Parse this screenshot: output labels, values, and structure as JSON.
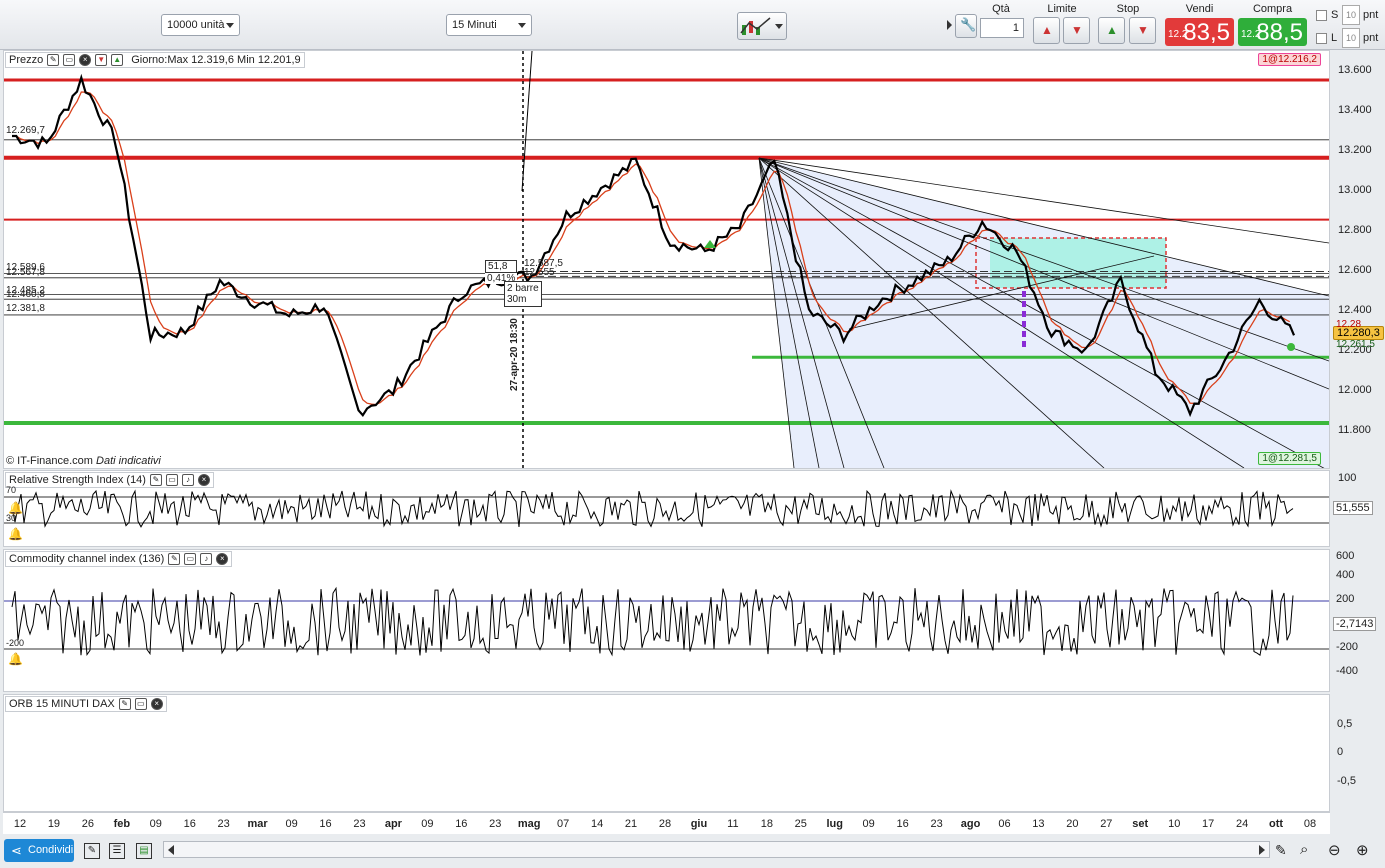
{
  "toolbar": {
    "units": "10000 unità",
    "timeframe": "15 Minuti",
    "qty_label": "Qtà",
    "qty_value": "1",
    "limit_label": "Limite",
    "stop_label": "Stop",
    "sell_label": "Vendi",
    "buy_label": "Compra",
    "sell_small": "12.2",
    "sell_big": "83,5",
    "buy_small": "12.2",
    "buy_big": "88,5",
    "s_label": "S",
    "l_label": "L",
    "s_pnt": "10",
    "l_pnt": "10",
    "pnt_label": "pnt",
    "colors": {
      "sell": "#e23a3a",
      "buy": "#2fae3a"
    }
  },
  "price_panel": {
    "title": "Prezzo",
    "info": "Giorno:Max 12.319,6 Min 12.201,9",
    "order_tag_top": "1@12.216,2",
    "order_tag_bottom": "1@12.281,5",
    "source": "© IT-Finance.com",
    "source_note": "Dati indicativi",
    "price_tag": "12.280,3",
    "price_tag2": "12.261,5",
    "price_tag3": "12.28",
    "levels_left": [
      "12.269,7",
      "12.589,6",
      "12.567,8",
      "12.485,2",
      "12.460,8",
      "12.381,8"
    ],
    "tooltip": {
      "line1": "51,8",
      "line2": "0,41%",
      "line3": "2 barre",
      "line4": "30m",
      "near1": "12.587,5",
      "near2": "12.555"
    },
    "vertical_label": "27-apr-20 18:30",
    "y_ticks": [
      "13.600",
      "13.400",
      "13.200",
      "13.000",
      "12.800",
      "12.600",
      "12.400",
      "12.200",
      "12.000",
      "11.800"
    ]
  },
  "rsi_panel": {
    "title": "Relative Strength Index (14)",
    "level_high": "70",
    "level_low": "30",
    "value": "51,555",
    "y_ticks": [
      "100"
    ]
  },
  "cci_panel": {
    "title": "Commodity channel index (136)",
    "level_low": "-200",
    "value": "-2,7143",
    "y_ticks": [
      "600",
      "400",
      "200",
      "-200",
      "-400"
    ]
  },
  "orb_panel": {
    "title": "ORB 15 MINUTI DAX",
    "y_ticks": [
      "0,5",
      "0",
      "-0,5"
    ]
  },
  "x_axis": [
    {
      "t": "12",
      "b": false
    },
    {
      "t": "19",
      "b": false
    },
    {
      "t": "26",
      "b": false
    },
    {
      "t": "feb",
      "b": true
    },
    {
      "t": "09",
      "b": false
    },
    {
      "t": "16",
      "b": false
    },
    {
      "t": "23",
      "b": false
    },
    {
      "t": "mar",
      "b": true
    },
    {
      "t": "09",
      "b": false
    },
    {
      "t": "16",
      "b": false
    },
    {
      "t": "23",
      "b": false
    },
    {
      "t": "apr",
      "b": true
    },
    {
      "t": "09",
      "b": false
    },
    {
      "t": "16",
      "b": false
    },
    {
      "t": "23",
      "b": false
    },
    {
      "t": "mag",
      "b": true
    },
    {
      "t": "07",
      "b": false
    },
    {
      "t": "14",
      "b": false
    },
    {
      "t": "21",
      "b": false
    },
    {
      "t": "28",
      "b": false
    },
    {
      "t": "giu",
      "b": true
    },
    {
      "t": "11",
      "b": false
    },
    {
      "t": "18",
      "b": false
    },
    {
      "t": "25",
      "b": false
    },
    {
      "t": "lug",
      "b": true
    },
    {
      "t": "09",
      "b": false
    },
    {
      "t": "16",
      "b": false
    },
    {
      "t": "23",
      "b": false
    },
    {
      "t": "ago",
      "b": true
    },
    {
      "t": "06",
      "b": false
    },
    {
      "t": "13",
      "b": false
    },
    {
      "t": "20",
      "b": false
    },
    {
      "t": "27",
      "b": false
    },
    {
      "t": "set",
      "b": true
    },
    {
      "t": "10",
      "b": false
    },
    {
      "t": "17",
      "b": false
    },
    {
      "t": "24",
      "b": false
    },
    {
      "t": "ott",
      "b": true
    },
    {
      "t": "08",
      "b": false
    }
  ],
  "bottom": {
    "share_label": "Condividi"
  },
  "chart_data": {
    "type": "line",
    "title": "",
    "ylim": [
      11700,
      13700
    ],
    "x": [
      "gen-12",
      "gen-19",
      "gen-26",
      "feb",
      "feb-09",
      "feb-16",
      "feb-23",
      "mar",
      "mar-09",
      "mar-16",
      "mar-23",
      "apr",
      "apr-09",
      "apr-16",
      "apr-23",
      "mag",
      "mag-07",
      "mag-14",
      "mag-21",
      "mag-28",
      "giu",
      "giu-11",
      "giu-18",
      "giu-25",
      "lug",
      "lug-09",
      "lug-16",
      "lug-23",
      "ago",
      "ago-06",
      "ago-13",
      "ago-20",
      "ago-27",
      "set",
      "set-10",
      "set-17",
      "set-24",
      "ott"
    ],
    "series": [
      {
        "values": [
          13280,
          13240,
          13560,
          13250,
          12280,
          12300,
          12550,
          12450,
          12380,
          12430,
          11900,
          12000,
          12250,
          12500,
          12560,
          12580,
          12880,
          13020,
          13150,
          12750,
          12700,
          12820,
          13150,
          12400,
          12280,
          12450,
          12550,
          12650,
          12850,
          12700,
          12300,
          12200,
          12550,
          12100,
          11900,
          12150,
          12450,
          12280
        ]
      }
    ],
    "horizontal_levels": [
      13560,
      13170,
      12860,
      12170,
      11840
    ]
  }
}
